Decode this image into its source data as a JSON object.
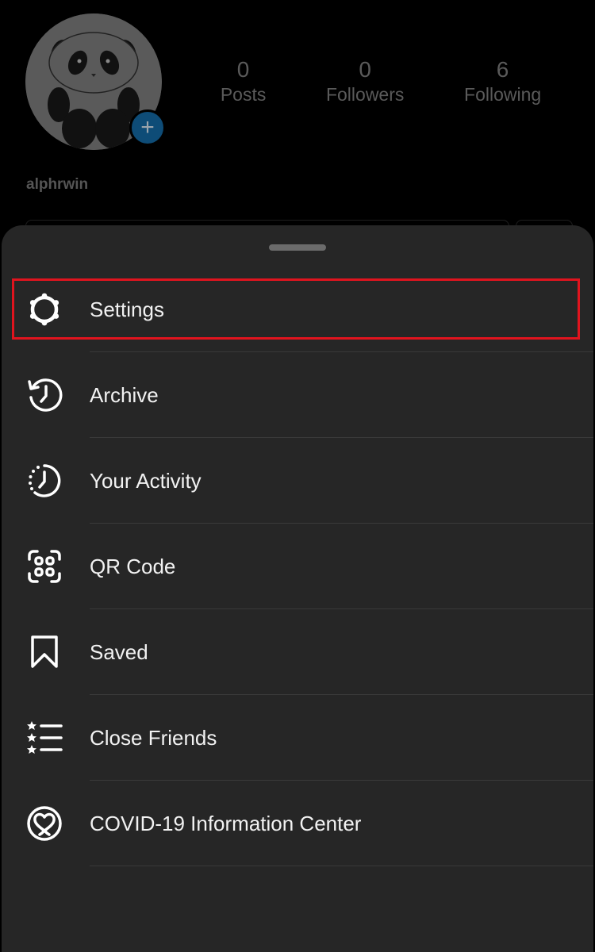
{
  "profile": {
    "username": "alphrwin",
    "stats": [
      {
        "value": "0",
        "label": "Posts"
      },
      {
        "value": "0",
        "label": "Followers"
      },
      {
        "value": "6",
        "label": "Following"
      }
    ],
    "add_story_glyph": "+"
  },
  "menu": {
    "items": [
      {
        "label": "Settings",
        "icon": "gear-icon",
        "highlighted": true
      },
      {
        "label": "Archive",
        "icon": "archive-clock-icon"
      },
      {
        "label": "Your Activity",
        "icon": "activity-clock-icon"
      },
      {
        "label": "QR Code",
        "icon": "qr-code-icon"
      },
      {
        "label": "Saved",
        "icon": "bookmark-icon"
      },
      {
        "label": "Close Friends",
        "icon": "close-friends-list-icon"
      },
      {
        "label": "COVID-19 Information Center",
        "icon": "covid-heart-icon"
      }
    ]
  },
  "colors": {
    "sheet_bg": "#262626",
    "highlight": "#e0141e",
    "badge": "#0e4c77"
  }
}
